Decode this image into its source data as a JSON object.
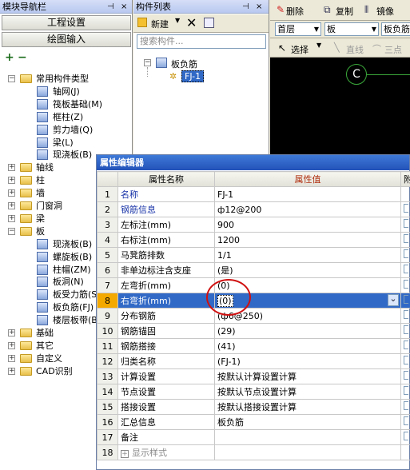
{
  "left_panel": {
    "title": "模块导航栏",
    "pin": "ꟼ",
    "close": "×",
    "btn_project": "工程设置",
    "btn_drawing": "绘图输入",
    "expand_all": "+",
    "collapse_all": "−",
    "tree": [
      {
        "label": "常用构件类型",
        "level": 0,
        "expanded": true
      },
      {
        "label": "轴网(J)",
        "level": 1
      },
      {
        "label": "筏板基础(M)",
        "level": 1
      },
      {
        "label": "框柱(Z)",
        "level": 1
      },
      {
        "label": "剪力墙(Q)",
        "level": 1
      },
      {
        "label": "梁(L)",
        "level": 1
      },
      {
        "label": "现浇板(B)",
        "level": 1
      },
      {
        "label": "轴线",
        "level": 0
      },
      {
        "label": "柱",
        "level": 0
      },
      {
        "label": "墙",
        "level": 0
      },
      {
        "label": "门窗洞",
        "level": 0
      },
      {
        "label": "梁",
        "level": 0
      },
      {
        "label": "板",
        "level": 0,
        "expanded": true
      },
      {
        "label": "现浇板(B)",
        "level": 1
      },
      {
        "label": "螺旋板(B)",
        "level": 1
      },
      {
        "label": "柱帽(ZM)",
        "level": 1
      },
      {
        "label": "板洞(N)",
        "level": 1
      },
      {
        "label": "板受力筋(S)",
        "level": 1
      },
      {
        "label": "板负筋(FJ)",
        "level": 1
      },
      {
        "label": "楼层板带(B)",
        "level": 1
      },
      {
        "label": "基础",
        "level": 0
      },
      {
        "label": "其它",
        "level": 0
      },
      {
        "label": "自定义",
        "level": 0
      },
      {
        "label": "CAD识别",
        "level": 0
      }
    ]
  },
  "mid_panel": {
    "title": "构件列表",
    "new_label": "新建",
    "search_placeholder": "搜索构件...",
    "tree_root": "板负筋",
    "tree_item": "FJ-1"
  },
  "right_panel": {
    "delete_label": "删除",
    "copy_label": "复制",
    "mirror_label": "镜像",
    "floor_select": "首层",
    "type_select": "板",
    "subtype_select": "板负筋",
    "select_label": "选择",
    "line_label": "直线",
    "arc_label": "三点",
    "axis_marker": "C"
  },
  "prop_editor": {
    "title": "属性编辑器",
    "col_name": "属性名称",
    "col_value": "属性值",
    "col_extra": "附",
    "rows": [
      {
        "n": "1",
        "name": "名称",
        "value": "FJ-1",
        "blue": true
      },
      {
        "n": "2",
        "name": "钢筋信息",
        "value": "ф12@200",
        "blue": true
      },
      {
        "n": "3",
        "name": "左标注(mm)",
        "value": "900",
        "blue": false
      },
      {
        "n": "4",
        "name": "右标注(mm)",
        "value": "1200",
        "blue": false
      },
      {
        "n": "5",
        "name": "马凳筋排数",
        "value": "1/1",
        "blue": false
      },
      {
        "n": "6",
        "name": "非单边标注含支座",
        "value": "(是)",
        "blue": false
      },
      {
        "n": "7",
        "name": "左弯折(mm)",
        "value": "(0)",
        "blue": false
      },
      {
        "n": "8",
        "name": "右弯折(mm)",
        "value": "(0)",
        "blue": false,
        "selected": true
      },
      {
        "n": "9",
        "name": "分布钢筋",
        "value": "(ф6@250)",
        "blue": false
      },
      {
        "n": "10",
        "name": "钢筋锚固",
        "value": "(29)",
        "blue": false
      },
      {
        "n": "11",
        "name": "钢筋搭接",
        "value": "(41)",
        "blue": false
      },
      {
        "n": "12",
        "name": "归类名称",
        "value": "(FJ-1)",
        "blue": false
      },
      {
        "n": "13",
        "name": "计算设置",
        "value": "按默认计算设置计算",
        "blue": false
      },
      {
        "n": "14",
        "name": "节点设置",
        "value": "按默认节点设置计算",
        "blue": false
      },
      {
        "n": "15",
        "name": "搭接设置",
        "value": "按默认搭接设置计算",
        "blue": false
      },
      {
        "n": "16",
        "name": "汇总信息",
        "value": "板负筋",
        "blue": false
      },
      {
        "n": "17",
        "name": "备注",
        "value": "",
        "blue": false
      },
      {
        "n": "18",
        "name": "显示样式",
        "value": "",
        "blue": false,
        "expandable": true
      }
    ]
  },
  "colors": {
    "accent": "#3169c6",
    "selection_num": "#f4a900",
    "annotation": "#d01010",
    "name_blue": "#1a35a8"
  }
}
